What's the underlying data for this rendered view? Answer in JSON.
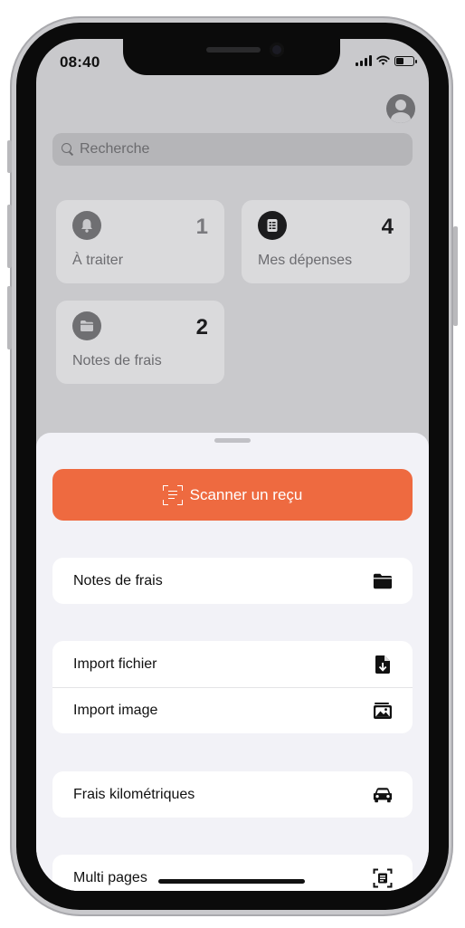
{
  "status_bar": {
    "time": "08:40"
  },
  "search": {
    "placeholder": "Recherche"
  },
  "tiles": [
    {
      "label": "À traiter",
      "count": "1",
      "icon": "bell-icon",
      "icon_bg": "#6f6f72",
      "count_color": "#7a7a7e"
    },
    {
      "label": "Mes dépenses",
      "count": "4",
      "icon": "receipt-icon",
      "icon_bg": "#1c1c1e",
      "count_color": "#1c1c1e"
    },
    {
      "label": "Notes de frais",
      "count": "2",
      "icon": "folder-icon",
      "icon_bg": "#6f6f72",
      "count_color": "#1c1c1e"
    }
  ],
  "sheet": {
    "scan_button_label": "Scanner un reçu",
    "groups": [
      [
        {
          "label": "Notes de frais",
          "icon": "folder-icon"
        }
      ],
      [
        {
          "label": "Import fichier",
          "icon": "file-download-icon"
        },
        {
          "label": "Import image",
          "icon": "image-stack-icon"
        }
      ],
      [
        {
          "label": "Frais kilométriques",
          "icon": "car-icon"
        }
      ],
      [
        {
          "label": "Multi pages",
          "icon": "scan-document-icon"
        }
      ]
    ]
  },
  "colors": {
    "accent": "#ee6a40",
    "sheet_bg": "#f2f2f7",
    "dim_bg": "#c9c9cc"
  }
}
